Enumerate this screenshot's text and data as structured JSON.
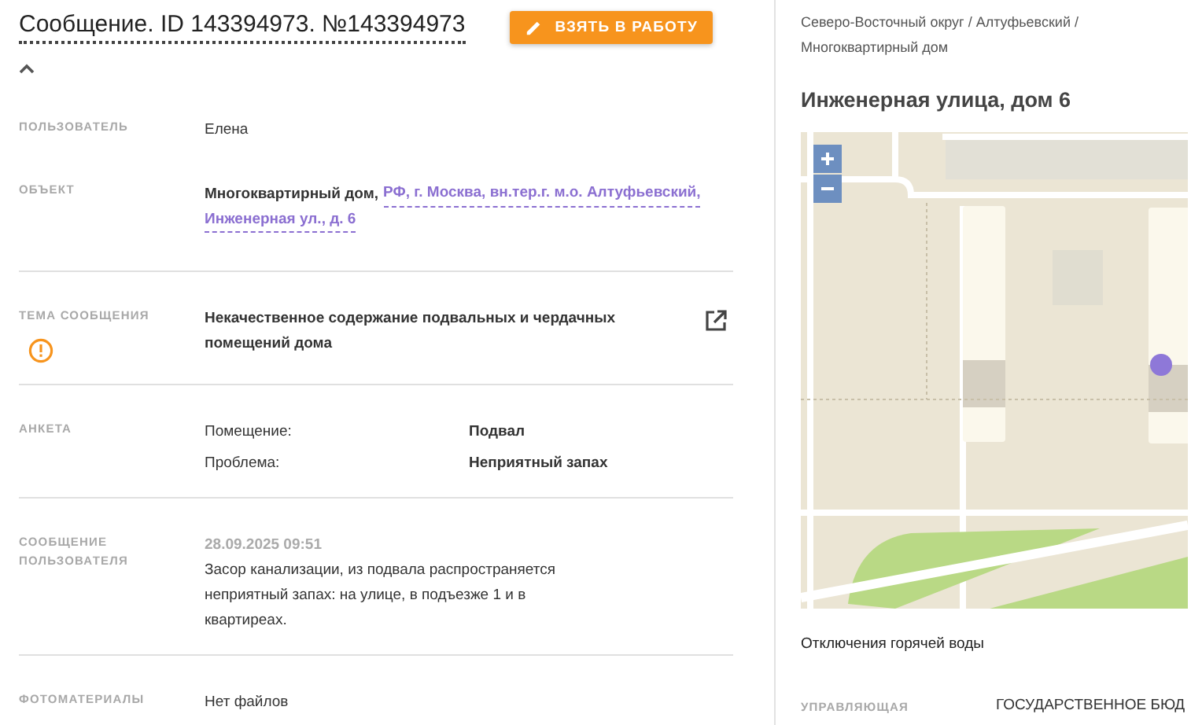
{
  "header": {
    "title": "Сообщение. ID 143394973. №143394973",
    "action_button": "ВЗЯТЬ В РАБОТУ",
    "details_expanded": true
  },
  "rows": [
    {
      "kind": "text",
      "label": "ПОЛЬЗОВАТЕЛЬ",
      "value": "Елена"
    },
    {
      "kind": "object",
      "label": "ОБЪЕКТ",
      "prefix": "Многоквартирный дом,",
      "link_lines": [
        "РФ, г. Москва, вн.тер.г. м.о. Алтуфьевский,",
        "Инженерная ул., д. 6"
      ]
    },
    {
      "kind": "topic",
      "label": "ТЕМА СООБЩЕНИЯ",
      "value": "Некачественное содержание подвальных и чердачных помещений дома",
      "warning": true
    },
    {
      "kind": "survey",
      "label": "АНКЕТА",
      "fields": [
        {
          "name": "Помещение:",
          "value": "Подвал"
        },
        {
          "name": "Проблема:",
          "value": "Неприятный запах"
        }
      ]
    },
    {
      "kind": "message",
      "label": "СООБЩЕНИЕ ПОЛЬЗОВАТЕЛЯ",
      "date": "28.09.2025 09:51",
      "text": "Засор канализации, из подвала распространяется неприятный запах: на улице, в подъезже 1 и в квартиреах."
    },
    {
      "kind": "text",
      "label": "ФОТОМАТЕРИАЛЫ",
      "value": "Нет файлов"
    }
  ],
  "side": {
    "breadcrumb": "Северо-Восточный округ / Алтуфьевский / Многоквартирный дом",
    "title": "Инженерная улица, дом 6",
    "section_title": "Отключения горячей воды",
    "info": [
      {
        "label": "УПРАВЛЯЮЩАЯ",
        "value": "ГОСУДАРСТВЕННОЕ БЮД"
      }
    ]
  }
}
